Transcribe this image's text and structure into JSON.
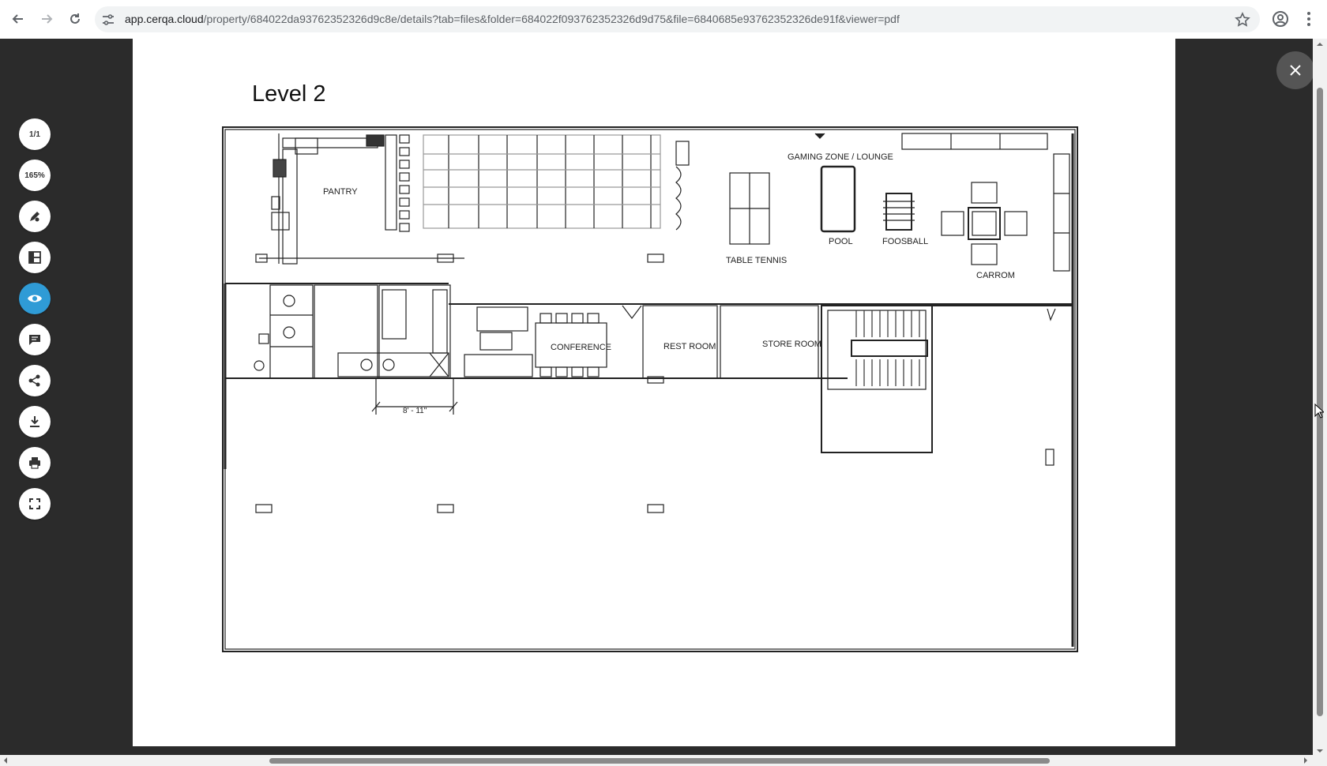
{
  "browser": {
    "url_domain": "app.cerqa.cloud",
    "url_path": "/property/684022da93762352326d9c8e/details?tab=files&folder=684022f093762352326d9d75&file=6840685e93762352326de91f&viewer=pdf"
  },
  "toolbar": {
    "page_indicator": "1/1",
    "zoom": "165%"
  },
  "document": {
    "title": "Level 2",
    "rooms": {
      "pantry": "PANTRY",
      "gaming": "GAMING ZONE / LOUNGE",
      "table_tennis": "TABLE TENNIS",
      "pool": "POOL",
      "foosball": "FOOSBALL",
      "carrom": "CARROM",
      "conference": "CONFERENCE",
      "rest_room": "REST ROOM",
      "store_room": "STORE ROOM",
      "dimension": "8' - 11\""
    }
  },
  "colors": {
    "accent": "#2f9bd6",
    "viewer_bg": "#2b2b2b"
  }
}
